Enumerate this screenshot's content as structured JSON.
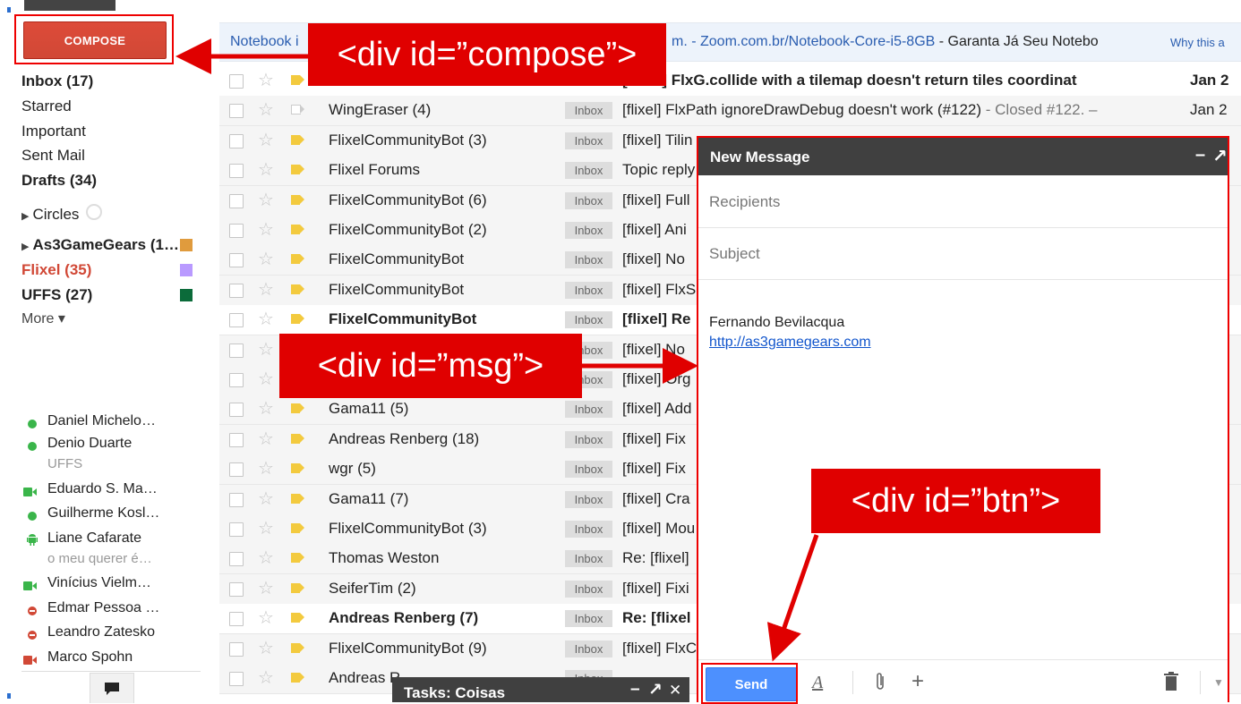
{
  "sidebar": {
    "compose_label": "COMPOSE",
    "nav": [
      {
        "label": "Inbox (17)",
        "bold": true
      },
      {
        "label": "Starred"
      },
      {
        "label": "Important"
      },
      {
        "label": "Sent Mail"
      },
      {
        "label": "Drafts (34)",
        "bold": true
      }
    ],
    "circles_label": "Circles",
    "labels": [
      {
        "label": "As3GameGears (1…",
        "color": "#e09b3d"
      },
      {
        "label": "Flixel (35)",
        "color": "#b99aff"
      },
      {
        "label": "UFFS (27)",
        "color": "#0b6b3a"
      }
    ],
    "more_label": "More ▾",
    "chat": [
      {
        "name": "Daniel Michelo…",
        "status": "online"
      },
      {
        "name": "Denio Duarte",
        "status": "online",
        "sub": "UFFS"
      },
      {
        "name": "Eduardo S. Ma…",
        "status": "video"
      },
      {
        "name": "Guilherme Kosl…",
        "status": "online"
      },
      {
        "name": "Liane Cafarate",
        "status": "android",
        "sub": "o meu querer é…"
      },
      {
        "name": "Vinícius Vielm…",
        "status": "video"
      },
      {
        "name": "Edmar Pessoa …",
        "status": "busy"
      },
      {
        "name": "Leandro Zatesko",
        "status": "busy"
      },
      {
        "name": "Marco Spohn",
        "status": "video-busy"
      }
    ]
  },
  "ad": {
    "part1": "Notebook i",
    "part2": "m. - Zoom.com.br/Notebook-Core-i5-8GB",
    "part3": " - Garanta Já Seu Notebo",
    "why": "Why this a"
  },
  "emails": [
    {
      "sender": "",
      "subject": "[flixel] FlxG.collide with a tilemap doesn't return tiles coordinat",
      "snippet": "",
      "date": "Jan 2",
      "unread": true,
      "imp": true
    },
    {
      "sender": "WingEraser (4)",
      "subject": "[flixel] FlxPath ignoreDrawDebug doesn't work (#122)",
      "snippet": " - Closed #122. –",
      "date": "Jan 2",
      "unread": false,
      "imp": false
    },
    {
      "sender": "FlixelCommunityBot (3)",
      "subject": "[flixel] Tilin",
      "snippet": "",
      "date": "",
      "unread": false,
      "imp": true
    },
    {
      "sender": "Flixel Forums",
      "subject": "Topic reply",
      "snippet": "",
      "date": "",
      "unread": false,
      "imp": true
    },
    {
      "sender": "FlixelCommunityBot (6)",
      "subject": "[flixel] Full",
      "snippet": "",
      "date": "",
      "unread": false,
      "imp": true
    },
    {
      "sender": "FlixelCommunityBot (2)",
      "subject": "[flixel] Ani",
      "snippet": "",
      "date": "",
      "unread": false,
      "imp": true
    },
    {
      "sender": "FlixelCommunityBot",
      "subject": "[flixel] No",
      "snippet": "",
      "date": "",
      "unread": false,
      "imp": true
    },
    {
      "sender": "FlixelCommunityBot",
      "subject": "[flixel] FlxS",
      "snippet": "",
      "date": "",
      "unread": false,
      "imp": true
    },
    {
      "sender": "FlixelCommunityBot",
      "subject": "[flixel] Re",
      "snippet": "",
      "date": "",
      "unread": true,
      "imp": true
    },
    {
      "sender": "",
      "subject": "[flixel] No",
      "snippet": "",
      "date": "",
      "unread": false,
      "imp": true
    },
    {
      "sender": "",
      "subject": "[flixel] Org",
      "snippet": "",
      "date": "",
      "unread": false,
      "imp": true
    },
    {
      "sender": "Gama11 (5)",
      "subject": "[flixel] Add",
      "snippet": "",
      "date": "",
      "unread": false,
      "imp": true
    },
    {
      "sender": "Andreas Renberg (18)",
      "subject": "[flixel] Fix",
      "snippet": "",
      "date": "",
      "unread": false,
      "imp": true
    },
    {
      "sender": "wgr (5)",
      "subject": "[flixel] Fix",
      "snippet": "",
      "date": "",
      "unread": false,
      "imp": true
    },
    {
      "sender": "Gama11 (7)",
      "subject": "[flixel] Cra",
      "snippet": "",
      "date": "",
      "unread": false,
      "imp": true
    },
    {
      "sender": "FlixelCommunityBot (3)",
      "subject": "[flixel] Mou",
      "snippet": "",
      "date": "",
      "unread": false,
      "imp": true
    },
    {
      "sender": "Thomas Weston",
      "subject": "Re: [flixel]",
      "snippet": "",
      "date": "",
      "unread": false,
      "imp": true
    },
    {
      "sender": "SeiferTim (2)",
      "subject": "[flixel] Fixi",
      "snippet": "",
      "date": "",
      "unread": false,
      "imp": true
    },
    {
      "sender": "Andreas Renberg (7)",
      "subject": "Re: [flixel",
      "snippet": "",
      "date": "",
      "unread": true,
      "imp": true
    },
    {
      "sender": "FlixelCommunityBot (9)",
      "subject": "[flixel] FlxC",
      "snippet": "",
      "date": "",
      "unread": false,
      "imp": true
    },
    {
      "sender": "Andreas R",
      "subject": "",
      "snippet": "",
      "date": "",
      "unread": false,
      "imp": true
    }
  ],
  "inbox_tag": "Inbox",
  "compose_window": {
    "title": "New Message",
    "min": "–",
    "popout": "↗",
    "recipients_placeholder": "Recipients",
    "subject_placeholder": "Subject",
    "signature_name": "Fernando Bevilacqua",
    "signature_link": "http://as3gamegears.com",
    "send_label": "Send"
  },
  "tasks": {
    "title": "Tasks: Coisas",
    "min": "–",
    "popout": "↗",
    "close": "✕"
  },
  "annotations": {
    "compose": "<div id=”compose”>",
    "msg": "<div id=”msg”>",
    "btn": "<div id=”btn”>"
  },
  "colors": {
    "accent_red": "#e00000",
    "compose_red": "#d14836",
    "send_blue": "#4d90fe",
    "header_dark": "#404040"
  }
}
